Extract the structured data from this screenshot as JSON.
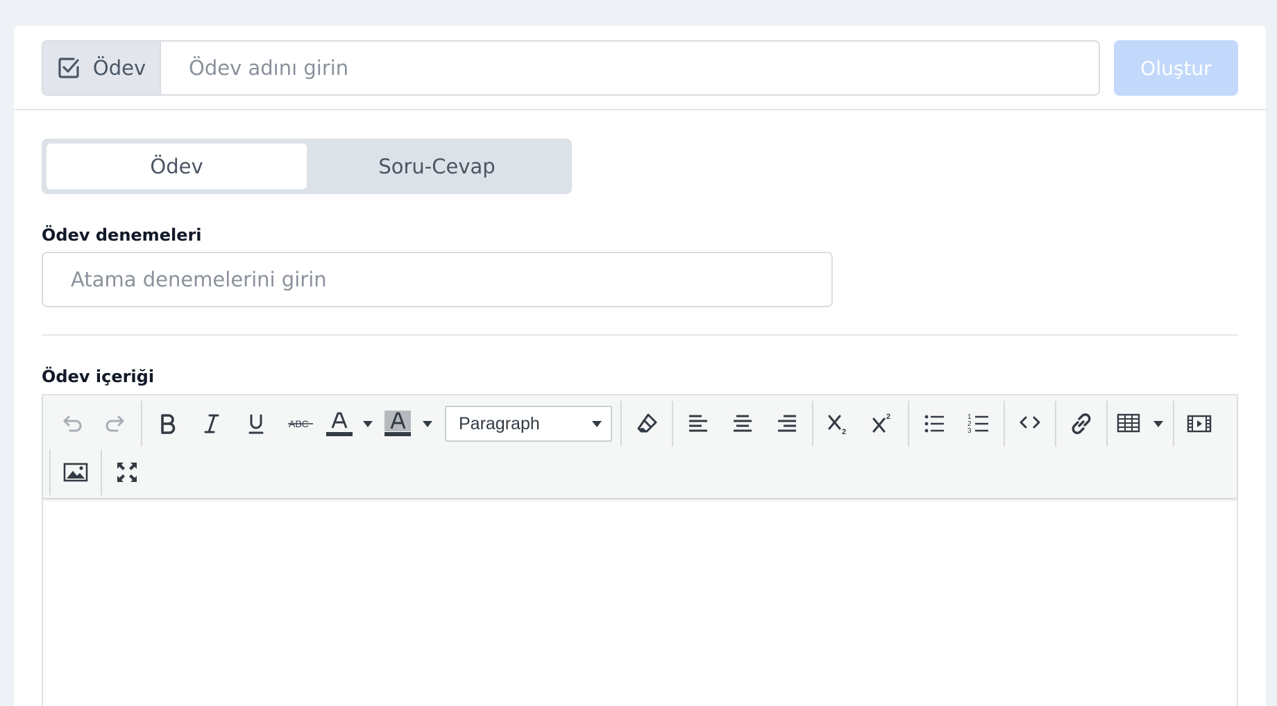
{
  "header": {
    "type_label": "Ödev",
    "title_placeholder": "Ödev adını girin",
    "create_label": "Oluştur"
  },
  "tabs": [
    {
      "label": "Ödev",
      "active": true
    },
    {
      "label": "Soru-Cevap",
      "active": false
    }
  ],
  "attempts": {
    "label": "Ödev denemeleri",
    "placeholder": "Atama denemelerini girin"
  },
  "content": {
    "label": "Ödev içeriği",
    "block_format": "Paragraph",
    "toolbar_icons": [
      "undo-icon",
      "redo-icon",
      "bold-icon",
      "italic-icon",
      "underline-icon",
      "strikethrough-icon",
      "text-color-icon",
      "highlight-color-icon",
      "clear-format-icon",
      "align-left-icon",
      "align-center-icon",
      "align-right-icon",
      "subscript-icon",
      "superscript-icon",
      "bullet-list-icon",
      "numbered-list-icon",
      "code-icon",
      "link-icon",
      "table-icon",
      "media-icon",
      "image-icon",
      "fullscreen-icon"
    ]
  },
  "colors": {
    "page_bg": "#eef1f5",
    "create_button": "#c3d9fb",
    "addon_bg": "#e2e6ec",
    "toolbar_bg": "#f5f6f6"
  }
}
